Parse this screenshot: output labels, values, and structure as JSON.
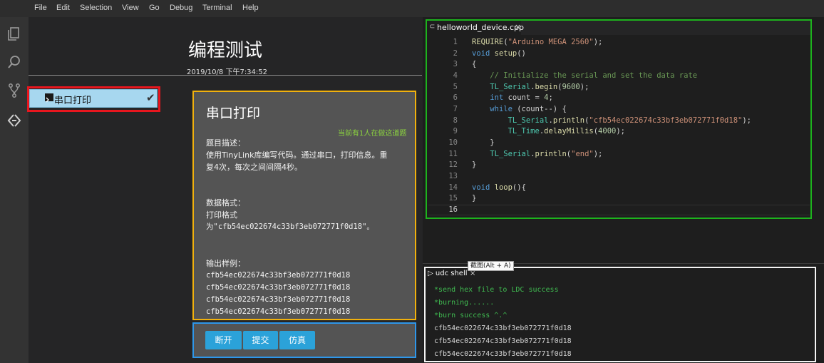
{
  "menu": [
    "File",
    "Edit",
    "Selection",
    "View",
    "Go",
    "Debug",
    "Terminal",
    "Help"
  ],
  "activity_icons": [
    "files-icon",
    "search-icon",
    "source-control-icon",
    "remote-icon"
  ],
  "page": {
    "title": "编程测试",
    "datetime": "2019/10/8 下午7:34:52"
  },
  "lesson_list": [
    {
      "label": "串口打印",
      "completed": true
    }
  ],
  "problem": {
    "title": "串口打印",
    "status": "当前有1人在做这道题",
    "description_heading": "题目描述：",
    "description_line1": "使用TinyLink库编写代码。通过串口，打印信息。重",
    "description_line2": "复4次，每次之间间隔4秒。",
    "format_heading": "数据格式：",
    "format_line1": "打印格式",
    "format_line2": "为\"cfb54ec022674c33bf3eb072771f0d18\"。",
    "output_heading": "输出样例：",
    "output_lines": [
      "cfb54ec022674c33bf3eb072771f0d18",
      "cfb54ec022674c33bf3eb072771f0d18",
      "cfb54ec022674c33bf3eb072771f0d18",
      "cfb54ec022674c33bf3eb072771f0d18"
    ]
  },
  "buttons": {
    "disconnect": "断开",
    "submit": "提交",
    "simulate": "仿真"
  },
  "editor": {
    "tab_title": "helloworld_device.cpp",
    "tab_close": "×",
    "line_numbers": [
      "1",
      "2",
      "3",
      "4",
      "5",
      "6",
      "7",
      "8",
      "9",
      "10",
      "11",
      "12",
      "13",
      "14",
      "15",
      "16"
    ]
  },
  "shell": {
    "tab_title": "udc shell",
    "tab_close": "×",
    "tooltip": "截图(Alt + A)",
    "lines": [
      "*send hex file to LDC success",
      "*burning......",
      "*burn success ^.^",
      "cfb54ec022674c33bf3eb072771f0d18",
      "cfb54ec022674c33bf3eb072771f0d18",
      "cfb54ec022674c33bf3eb072771f0d18"
    ]
  },
  "colors": {
    "lesson_highlight": "#e8161e",
    "problem_border": "#f1b10d",
    "button_panel_border": "#2e97ea",
    "editor_border": "#1db31d",
    "shell_border": "#f4f4f4",
    "button_bg": "#2ba2d9"
  }
}
